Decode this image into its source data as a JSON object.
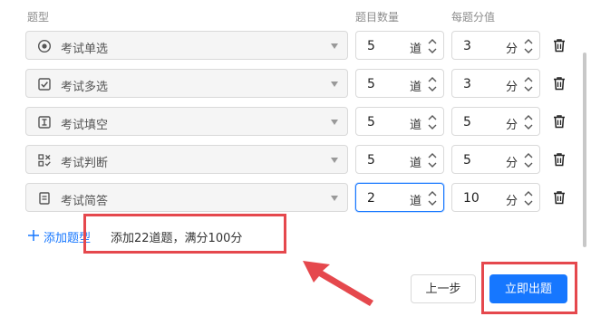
{
  "headers": {
    "type": "题型",
    "count": "题目数量",
    "score": "每题分值"
  },
  "rows": [
    {
      "type_label": "考试单选",
      "icon": "radio-icon",
      "count": "5",
      "count_unit": "道",
      "score": "3",
      "score_unit": "分"
    },
    {
      "type_label": "考试多选",
      "icon": "checkbox-icon",
      "count": "5",
      "count_unit": "道",
      "score": "3",
      "score_unit": "分"
    },
    {
      "type_label": "考试填空",
      "icon": "text-cursor-icon",
      "count": "5",
      "count_unit": "道",
      "score": "5",
      "score_unit": "分"
    },
    {
      "type_label": "考试判断",
      "icon": "judge-icon",
      "count": "5",
      "count_unit": "道",
      "score": "5",
      "score_unit": "分"
    },
    {
      "type_label": "考试简答",
      "icon": "document-icon",
      "count": "2",
      "count_unit": "道",
      "score": "10",
      "score_unit": "分"
    }
  ],
  "add_type_label": "添加题型",
  "summary": "添加22道题，满分100分",
  "buttons": {
    "prev": "上一步",
    "submit": "立即出题"
  },
  "colors": {
    "primary": "#1677ff",
    "highlight": "#e5484d"
  }
}
